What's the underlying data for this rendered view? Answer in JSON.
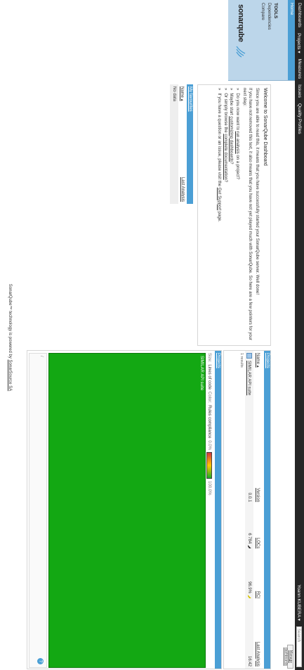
{
  "topbar": {
    "nav": [
      "Dashboards",
      "Projects ▾",
      "Measures",
      "Issues",
      "Quality Profiles"
    ],
    "user": "Yoann KUBERA ▾",
    "search_placeholder": "Search"
  },
  "sidebar": {
    "home": "Home",
    "tools_title": "TOOLS",
    "items": [
      "Dependencies",
      "Compare"
    ],
    "logo_text": "sonarqube"
  },
  "manage_button": "Manage dashboards",
  "welcome": {
    "title": "Welcome to SonarQube Dashboard",
    "p1": "Since you are able to read this, it means that you have successfully started your SonarQube server. Well done!",
    "p2": "If you have not removed this text, it also means that you have not yet played much with SonarQube. So here are a few pointers for your next step:",
    "bullets": [
      {
        "pre": "Do you now want to ",
        "link": "run analysis",
        "post": " on a project?"
      },
      {
        "pre": "Maybe start ",
        "link": "customizing dashboards",
        "post": "?"
      },
      {
        "pre": "Or simply browse the ",
        "link": "complete documentation",
        "post": "?"
      },
      {
        "pre": "If you have a question or an issue, please visit the ",
        "link": "Get Support",
        "post": " page."
      }
    ]
  },
  "favourites": {
    "title": "My favourites",
    "col_name": "Name ▴",
    "col_last": "Last Analysis",
    "empty": "No data"
  },
  "projects": {
    "title": "Projects",
    "headers": {
      "name": "Name ▴",
      "version": "Version",
      "locs": "LOCs",
      "rci": "RCI",
      "last": "Last Analysis"
    },
    "rows": [
      {
        "name": "SIMILAR API suite",
        "version": "0.0.1",
        "locs": "6 784",
        "rci": "96.9%",
        "last": "16:42"
      }
    ],
    "results": "1 results"
  },
  "treemap": {
    "title": "Projects",
    "size_label": "Size:",
    "size_metric": "Lines of code",
    "color_label": "Color:",
    "color_metric": "Rules compliance",
    "scale_min": "0.0%",
    "scale_max": "100.0%",
    "cell_label": "SIMILAR API suite",
    "cell_color": "#13a813",
    "help": "?"
  },
  "footer": {
    "text": "SonarQube™ technology is powered by ",
    "link": "SonarSource SA"
  },
  "colors": {
    "accent": "#4b9fd5",
    "topbar": "#262626",
    "sidebar": "#bcd6ea"
  }
}
